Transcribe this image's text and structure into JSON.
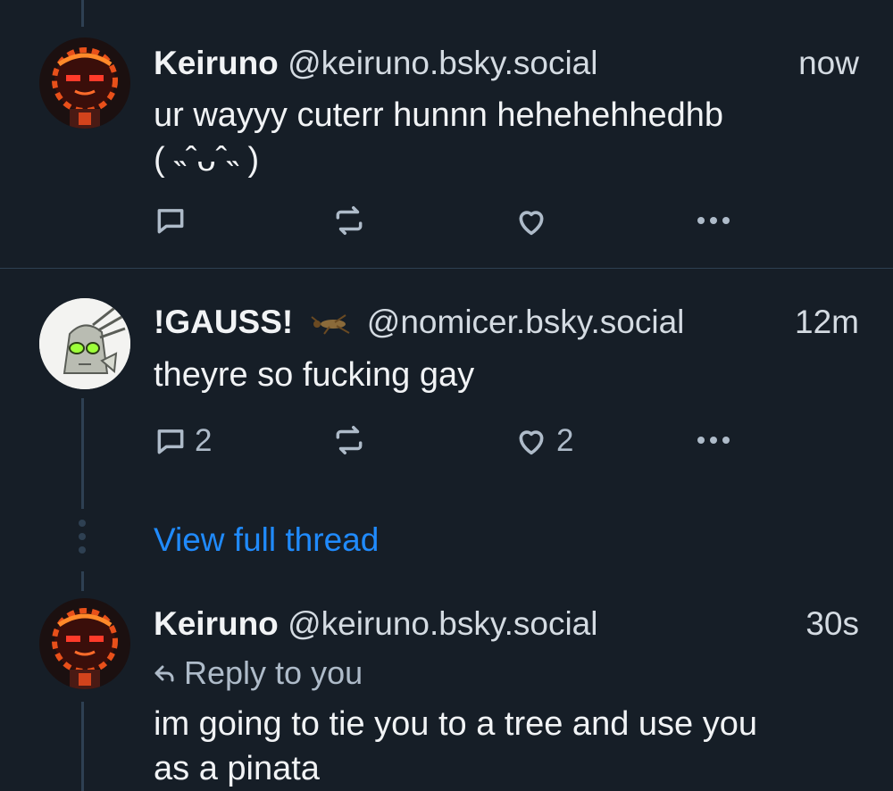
{
  "posts": [
    {
      "name": "Keiruno",
      "handle": "@keiruno.bsky.social",
      "time": "now",
      "text": "ur wayyy cuterr hunnn hehehehhedhb\n( ˵ˆᴗˆ˵ )",
      "counts": {
        "reply": "",
        "repost": "",
        "like": ""
      }
    },
    {
      "name": "!GAUSS!",
      "handle": "@nomicer.bsky.social",
      "time": "12m",
      "text": "theyre so fucking gay",
      "counts": {
        "reply": "2",
        "repost": "",
        "like": "2"
      }
    },
    {
      "name": "Keiruno",
      "handle": "@keiruno.bsky.social",
      "time": "30s",
      "reply_to": "Reply to you",
      "text": "im going to tie you to a tree and use you\nas a pinata"
    }
  ],
  "view_full_thread": "View full thread",
  "colors": {
    "background": "#161e27",
    "accent": "#208bfe",
    "muted": "#aebbc9",
    "divider": "#2e4052"
  },
  "icons": [
    "reply-icon",
    "repost-icon",
    "like-icon",
    "more-icon",
    "insect-emoji-icon",
    "reply-arrow-icon"
  ]
}
